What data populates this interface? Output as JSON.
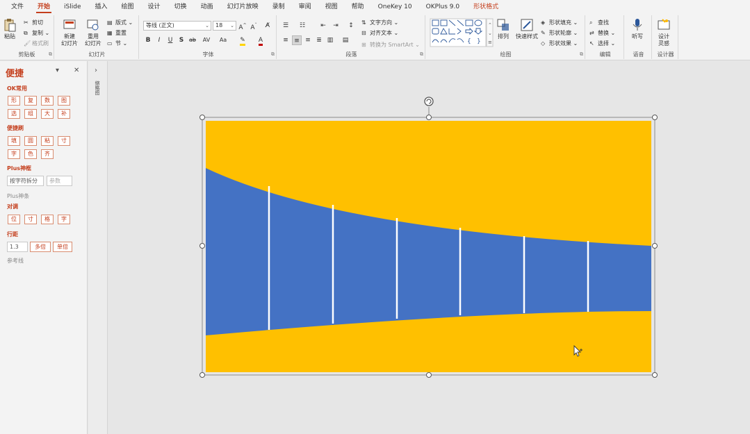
{
  "menu": {
    "tabs": [
      "文件",
      "开始",
      "iSlide",
      "插入",
      "绘图",
      "设计",
      "切换",
      "动画",
      "幻灯片放映",
      "录制",
      "审阅",
      "视图",
      "帮助",
      "OneKey 10",
      "OKPlus 9.0",
      "形状格式"
    ],
    "active": "开始",
    "accent": "形状格式"
  },
  "ribbon": {
    "clipboard": {
      "label": "剪贴板",
      "paste": "粘贴",
      "cut": "剪切",
      "copy": "复制",
      "format_painter": "格式刷"
    },
    "slides": {
      "label": "幻灯片",
      "new_slide": "新建\n幻灯片",
      "reuse": "重用\n幻灯片",
      "layout": "版式",
      "reset": "重置",
      "section": "节"
    },
    "font": {
      "label": "字体",
      "font_name": "等线 (正文)",
      "font_size": "18",
      "bold": "B",
      "italic": "I",
      "underline": "U",
      "shadow": "S",
      "strike": "ab",
      "spacing": "AV",
      "case": "Aa"
    },
    "paragraph": {
      "label": "段落",
      "text_direction": "文字方向",
      "align_text": "对齐文本",
      "smartart": "转换为 SmartArt"
    },
    "drawing": {
      "label": "绘图",
      "arrange": "排列",
      "quick_styles": "快速样式",
      "fill": "形状填充",
      "outline": "形状轮廓",
      "effects": "形状效果"
    },
    "editing": {
      "label": "编辑",
      "find": "查找",
      "replace": "替换",
      "select": "选择"
    },
    "voice": {
      "label": "语音",
      "dictate": "听写"
    },
    "designer": {
      "label": "设计器",
      "design_ideas": "设计\n灵感"
    }
  },
  "sidepanel": {
    "title": "便捷",
    "sections": {
      "ok_common": {
        "label": "OK常用",
        "row1": [
          "形",
          "复",
          "数",
          "图"
        ],
        "row2": [
          "选",
          "组",
          "大",
          "补"
        ]
      },
      "quick_brush": {
        "label": "便捷刷",
        "row1": [
          "填",
          "圆",
          "粘",
          "寸"
        ],
        "row2": [
          "字",
          "色",
          "齐"
        ]
      },
      "plus_frame": {
        "label": "Plus神框",
        "input_value": "按字符拆分",
        "input_placeholder": "参数"
      },
      "plus_bar": {
        "label": "Plus神条"
      },
      "align": {
        "label": "对调",
        "row1": [
          "位",
          "寸",
          "格",
          "字"
        ]
      },
      "line_spacing": {
        "label": "行距",
        "value": "1.3",
        "multi": "多倍",
        "single": "单倍"
      },
      "guides": {
        "label": "参考线"
      }
    }
  },
  "thumbstrip": {
    "label": "缩略图"
  },
  "slide": {
    "background_color": "#ffc000",
    "shape_color": "#4472c4",
    "divider_color": "#ffffff",
    "accent_color": "#c43e1c"
  }
}
